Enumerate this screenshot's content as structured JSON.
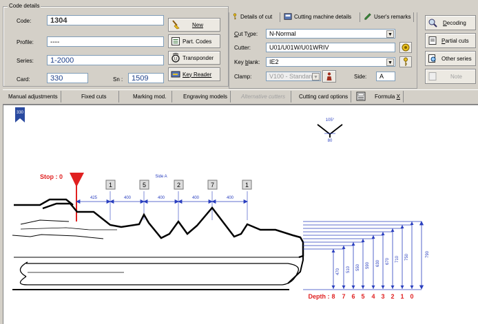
{
  "code_details": {
    "title": "Code details",
    "code_label": "Code:",
    "code_value": "1304",
    "profile_label": "Profile:",
    "profile_value": "----",
    "series_label": "Series:",
    "series_value": "1-2000",
    "card_label": "Card:",
    "card_value": "330",
    "sn_label": "Sn :",
    "sn_value": "1509"
  },
  "action_buttons": {
    "new": "New",
    "part_codes": "Part. Codes",
    "transponder": "Transponder",
    "key_reader": "Key Reader"
  },
  "tabs": [
    "Details of cut",
    "Cutting machine details",
    "User's remarks"
  ],
  "cut_details": {
    "cut_type_label": "Cut Type:",
    "cut_type_value": "N-Normal",
    "cutter_label": "Cutter:",
    "cutter_value": "U01/U01W/U01WRIV",
    "key_blank_label": "Key blank:",
    "key_blank_value": "IE2",
    "clamp_label": "Clamp:",
    "clamp_value": "V100 - Standard",
    "side_label": "Side:",
    "side_value": "A"
  },
  "right_buttons": {
    "decoding": "Decoding",
    "partial_cuts": "Partial cuts",
    "other_series": "Other series",
    "note": "Note"
  },
  "toolbar": [
    "Manual adjustments",
    "Fixed cuts",
    "Marking mod.",
    "Engraving models",
    "Alternative cutters",
    "Cutting card options",
    "Formula X"
  ],
  "bookmark_label": "330",
  "angle": {
    "angle_label": "105°",
    "width_label": "80"
  },
  "key_drawing": {
    "stop_label": "Stop : 0",
    "side_label": "Side A",
    "cut_codes": [
      "1",
      "5",
      "2",
      "7",
      "1"
    ],
    "spacings": [
      "425",
      "400",
      "400",
      "400",
      "400"
    ],
    "depth_label": "Depth :",
    "depth_levels": [
      "8",
      "7",
      "6",
      "5",
      "4",
      "3",
      "2",
      "1",
      "0"
    ],
    "depth_values": [
      "470",
      "510",
      "550",
      "590",
      "630",
      "670",
      "710",
      "750",
      "790"
    ]
  },
  "colors": {
    "accent_red": "#e02020",
    "dim_blue": "#2a3fbf",
    "bookmark": "#2a4aa0"
  }
}
